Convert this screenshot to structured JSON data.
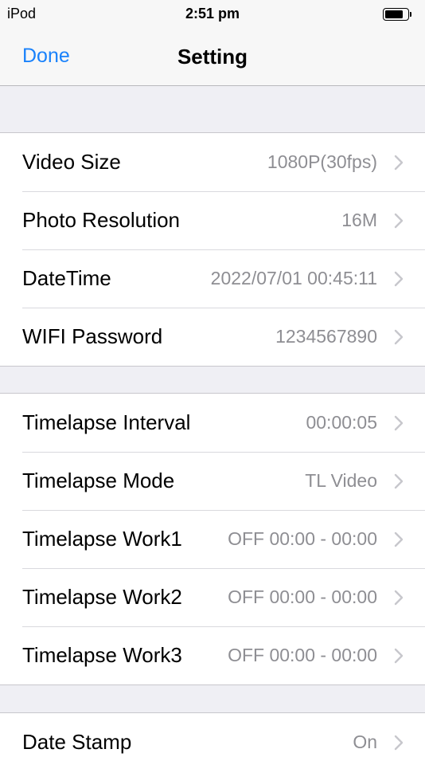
{
  "status_bar": {
    "carrier": "iPod",
    "time": "2:51 pm"
  },
  "nav": {
    "done_label": "Done",
    "title": "Setting"
  },
  "groups": [
    {
      "rows": [
        {
          "label": "Video Size",
          "value": "1080P(30fps)"
        },
        {
          "label": "Photo Resolution",
          "value": "16M"
        },
        {
          "label": "DateTime",
          "value": "2022/07/01 00:45:11"
        },
        {
          "label": "WIFI Password",
          "value": "1234567890"
        }
      ]
    },
    {
      "rows": [
        {
          "label": "Timelapse Interval",
          "value": "00:00:05"
        },
        {
          "label": "Timelapse Mode",
          "value": "TL Video"
        },
        {
          "label": "Timelapse Work1",
          "value": "OFF 00:00 - 00:00"
        },
        {
          "label": "Timelapse Work2",
          "value": "OFF 00:00 - 00:00"
        },
        {
          "label": "Timelapse Work3",
          "value": "OFF 00:00 - 00:00"
        }
      ]
    },
    {
      "rows": [
        {
          "label": "Date Stamp",
          "value": "On"
        }
      ]
    }
  ],
  "icons": {
    "row_accessory": "chevron-right-icon",
    "battery": "battery-icon"
  },
  "colors": {
    "tint": "#1a82fb",
    "secondary_text": "#8e8e93",
    "chevron": "#c7c7cc",
    "grouped_background": "#efeff4"
  }
}
